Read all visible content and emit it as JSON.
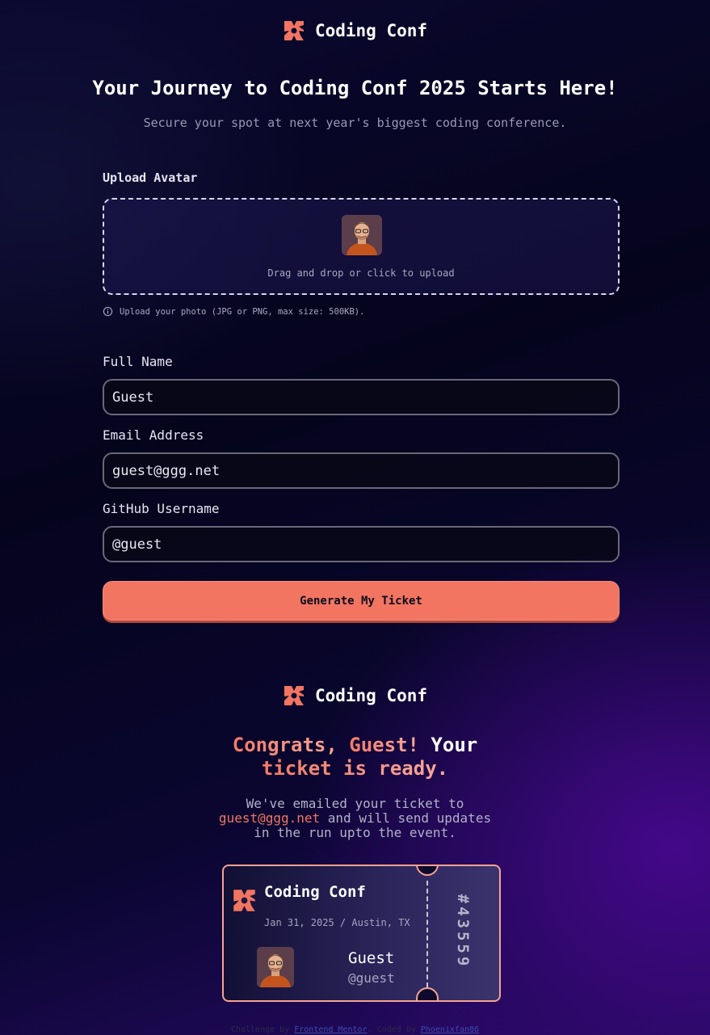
{
  "brand": {
    "name": "Coding Conf",
    "accent": "#f27562"
  },
  "form_page": {
    "headline": "Your Journey to Coding Conf 2025 Starts Here!",
    "subline": "Secure your spot at next year's biggest coding conference.",
    "avatar": {
      "label": "Upload Avatar",
      "drop_text": "Drag and drop or click to upload",
      "hint": "Upload your photo (JPG or PNG, max size: 500KB)."
    },
    "fields": {
      "full_name": {
        "label": "Full Name",
        "value": "Guest"
      },
      "email": {
        "label": "Email Address",
        "value": "guest@ggg.net"
      },
      "github": {
        "label": "GitHub Username",
        "value": "@guest"
      }
    },
    "submit_label": "Generate My Ticket"
  },
  "ticket_page": {
    "congrats_prefix": "Congrats, ",
    "congrats_name": "Guest!",
    "congrats_mid": " Your",
    "congrats_line2": "ticket is ready.",
    "emailed_line1": "We've emailed your ticket to",
    "emailed_email": "guest@ggg.net",
    "emailed_rest": " and will send updates",
    "emailed_line3": "in the run upto the event."
  },
  "ticket": {
    "event_name": "Coding Conf",
    "date_location": "Jan 31, 2025 / Austin, TX",
    "user_name": "Guest",
    "user_handle": "@guest",
    "number": "#43559"
  },
  "footer": {
    "prefix": "Challenge by ",
    "link1": "Frontend Mentor",
    "mid": ". Coded by ",
    "link2": "Phoenixfan86"
  },
  "icons": [
    "logo-mark-icon",
    "info-icon"
  ]
}
